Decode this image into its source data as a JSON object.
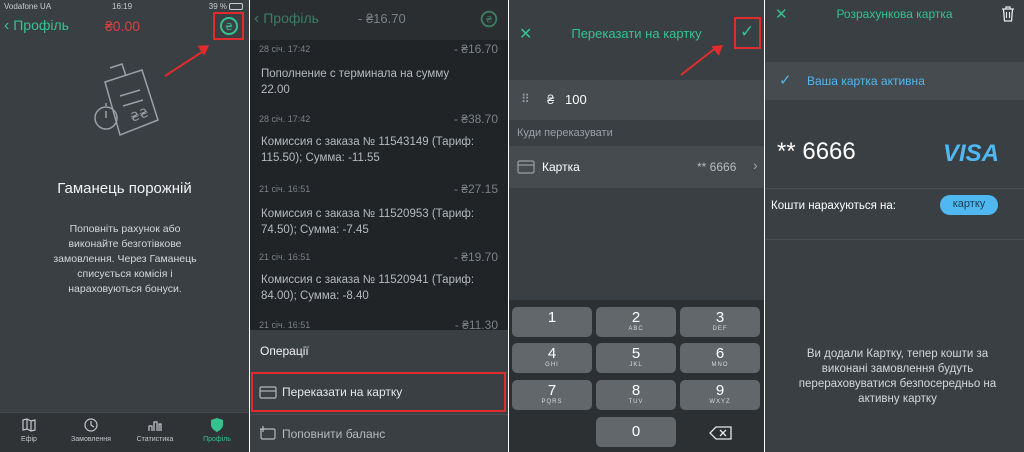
{
  "panel1": {
    "status": {
      "carrier": "Vodafone UA",
      "time": "16:19",
      "battery": "39 %"
    },
    "back_label": "Профіль",
    "balance": "₴0.00",
    "empty_title": "Гаманець порожній",
    "empty_text": "Поповніть рахунок або виконайте безготівкове замовлення. Через Гаманець списується комісія і нараховуються бонуси.",
    "tabs": [
      {
        "label": "Ефір",
        "icon": "map-icon"
      },
      {
        "label": "Замовлення",
        "icon": "history-icon"
      },
      {
        "label": "Статистика",
        "icon": "stats-icon"
      },
      {
        "label": "Профіль",
        "icon": "shield-icon"
      }
    ],
    "accent": "#34c38f"
  },
  "panel2": {
    "back_label": "Профіль",
    "balance": "- ₴16.70",
    "rows": [
      {
        "date": "28 січ. 17:42",
        "amount": "- ₴16.70",
        "text": "Пополнение с терминала на сумму 22.00"
      },
      {
        "date": "28 січ. 17:42",
        "amount": "- ₴38.70",
        "text": "Комиссия с заказа № 11543149 (Тариф: 115.50); Сумма: -11.55"
      },
      {
        "date": "21 січ. 16:51",
        "amount": "- ₴27.15",
        "text": "Комиссия с заказа № 11520953 (Тариф: 74.50); Сумма: -7.45"
      },
      {
        "date": "21 січ. 16:51",
        "amount": "- ₴19.70",
        "text": "Комиссия с заказа № 11520941 (Тариф: 84.00); Сумма: -8.40"
      },
      {
        "date": "21 січ. 16:51",
        "amount": "- ₴11.30",
        "text": ""
      }
    ],
    "sheet_title": "Операції",
    "sheet_items": [
      "Переказати на картку",
      "Поповнити баланс"
    ]
  },
  "panel3": {
    "title": "Переказати на картку",
    "currency": "₴",
    "amount": "100",
    "dest_label": "Куди переказувати",
    "card_label": "Картка",
    "card_mask": "** 6666",
    "keys": [
      {
        "d": "1",
        "l": ""
      },
      {
        "d": "2",
        "l": "ABC"
      },
      {
        "d": "3",
        "l": "DEF"
      },
      {
        "d": "4",
        "l": "GHI"
      },
      {
        "d": "5",
        "l": "JKL"
      },
      {
        "d": "6",
        "l": "MNO"
      },
      {
        "d": "7",
        "l": "PQRS"
      },
      {
        "d": "8",
        "l": "TUV"
      },
      {
        "d": "9",
        "l": "WXYZ"
      },
      {
        "d": "0",
        "l": ""
      }
    ]
  },
  "panel4": {
    "title": "Розрахункова картка",
    "active_text": "Ваша картка активна",
    "card_number": "** 6666",
    "brand": "VISA",
    "receive_label": "Кошти нарахуються на:",
    "receive_value": "картку",
    "info_text": "Ви додали Картку, тепер кошти за виконані замовлення будуть перераховуватися безпосередньо на активну картку",
    "brand_color": "#4fb8f0"
  }
}
